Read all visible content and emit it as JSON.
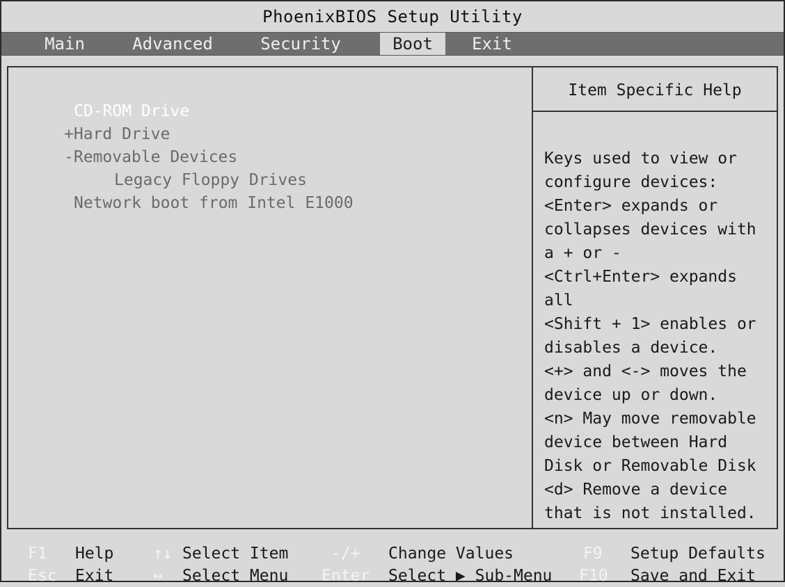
{
  "title": "PhoenixBIOS Setup Utility",
  "tabs": [
    {
      "label": "Main",
      "active": false
    },
    {
      "label": "Advanced",
      "active": false
    },
    {
      "label": "Security",
      "active": false
    },
    {
      "label": "Boot",
      "active": true
    },
    {
      "label": "Exit",
      "active": false
    }
  ],
  "boot_items": [
    {
      "label": "CD-ROM Drive",
      "selected": true
    },
    {
      "label": "+Hard Drive",
      "selected": false
    },
    {
      "label": "-Removable Devices",
      "selected": false
    },
    {
      "label": "Legacy Floppy Drives",
      "selected": false
    },
    {
      "label": "Network boot from Intel E1000",
      "selected": false
    }
  ],
  "help": {
    "header": "Item Specific Help",
    "lines": [
      "Keys used to view or",
      "configure devices:",
      "<Enter> expands or",
      "collapses devices with",
      "a + or -",
      "<Ctrl+Enter> expands",
      "all",
      "<Shift + 1> enables or",
      "disables a device.",
      "<+> and <-> moves the",
      "device up or down.",
      "<n> May move removable",
      "device between Hard",
      "Disk or Removable Disk",
      "<d> Remove a device",
      "that is not installed."
    ]
  },
  "footer": {
    "row1": [
      {
        "key": "F1",
        "desc": "Help"
      },
      {
        "key": "↑↓",
        "desc": "Select Item"
      },
      {
        "key": "-/+",
        "desc": "Change Values"
      },
      {
        "key": "F9",
        "desc": "Setup Defaults"
      }
    ],
    "row2": [
      {
        "key": "Esc",
        "desc": "Exit"
      },
      {
        "key": "↔",
        "desc": "Select Menu"
      },
      {
        "key": "Enter",
        "desc": "Select ▶ Sub-Menu"
      },
      {
        "key": "F10",
        "desc": "Save and Exit"
      }
    ]
  }
}
